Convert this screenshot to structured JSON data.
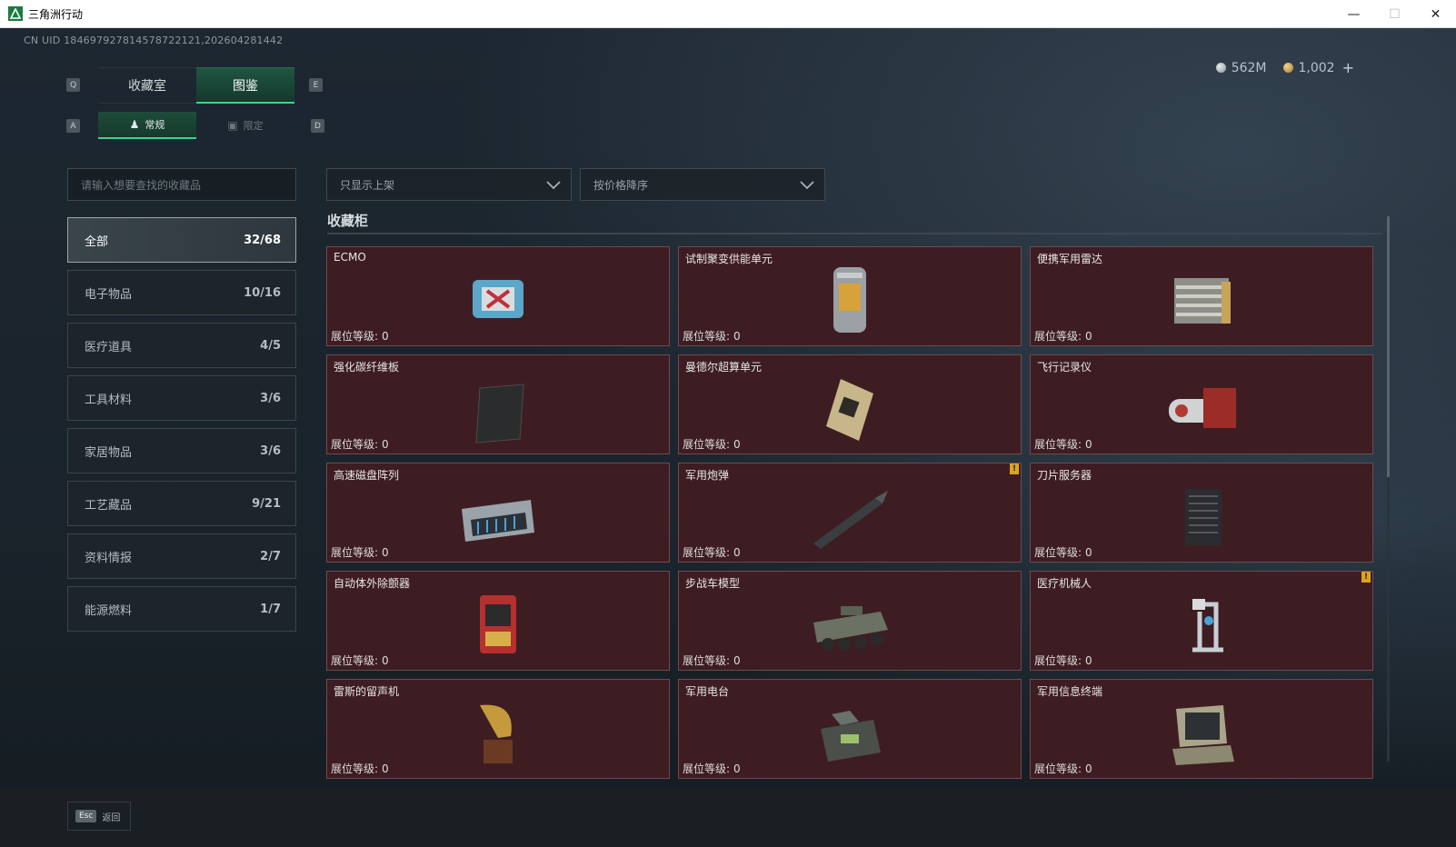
{
  "window": {
    "title": "三角洲行动",
    "minimize": "—",
    "maximize": "☐",
    "close": "✕"
  },
  "header": {
    "uid": "CN UID 184697927814578722121,202604281442",
    "currency": [
      {
        "icon": "silver-coin-icon",
        "value": "562M"
      },
      {
        "icon": "gold-coin-icon",
        "value": "1,002"
      }
    ],
    "add_label": "+"
  },
  "tabs": {
    "key_left": "Q",
    "key_right": "E",
    "main": [
      {
        "label": "收藏室"
      },
      {
        "label": "图鉴"
      }
    ],
    "key_sub_left": "A",
    "key_sub_right": "D",
    "sub": [
      {
        "label": "常规",
        "icon": "figure-icon"
      },
      {
        "label": "限定",
        "icon": "frame-icon"
      }
    ]
  },
  "search": {
    "placeholder": "请输入想要查找的收藏品"
  },
  "filters": {
    "shelf": "只显示上架",
    "sort": "按价格降序"
  },
  "categories": [
    {
      "label": "全部",
      "count": "32/68"
    },
    {
      "label": "电子物品",
      "count": "10/16"
    },
    {
      "label": "医疗道具",
      "count": "4/5"
    },
    {
      "label": "工具材料",
      "count": "3/6"
    },
    {
      "label": "家居物品",
      "count": "3/6"
    },
    {
      "label": "工艺藏品",
      "count": "9/21"
    },
    {
      "label": "资料情报",
      "count": "2/7"
    },
    {
      "label": "能源燃料",
      "count": "1/7"
    }
  ],
  "section": {
    "title": "收藏柜"
  },
  "level_label": "展位等级:",
  "items": [
    {
      "name": "ECMO",
      "level": "0",
      "icon": "ecmo-icon"
    },
    {
      "name": "试制聚变供能单元",
      "level": "0",
      "icon": "fusion-cell-icon"
    },
    {
      "name": "便携军用雷达",
      "level": "0",
      "icon": "radar-icon"
    },
    {
      "name": "强化碳纤维板",
      "level": "0",
      "icon": "carbon-plate-icon"
    },
    {
      "name": "曼德尔超算单元",
      "level": "0",
      "icon": "cpu-icon"
    },
    {
      "name": "飞行记录仪",
      "level": "0",
      "icon": "flight-recorder-icon"
    },
    {
      "name": "高速磁盘阵列",
      "level": "0",
      "icon": "disk-array-icon"
    },
    {
      "name": "军用炮弹",
      "level": "0",
      "icon": "shell-icon",
      "warn": "!"
    },
    {
      "name": "刀片服务器",
      "level": "0",
      "icon": "server-icon"
    },
    {
      "name": "自动体外除颤器",
      "level": "0",
      "icon": "defibrillator-icon"
    },
    {
      "name": "步战车模型",
      "level": "0",
      "icon": "ifv-model-icon"
    },
    {
      "name": "医疗机械人",
      "level": "0",
      "icon": "medical-robot-icon",
      "warn": "!"
    },
    {
      "name": "雷斯的留声机",
      "level": "0",
      "icon": "gramophone-icon"
    },
    {
      "name": "军用电台",
      "level": "0",
      "icon": "radio-icon"
    },
    {
      "name": "军用信息终端",
      "level": "0",
      "icon": "terminal-icon"
    }
  ],
  "footer": {
    "esc_key": "Esc",
    "back_label": "返回"
  }
}
